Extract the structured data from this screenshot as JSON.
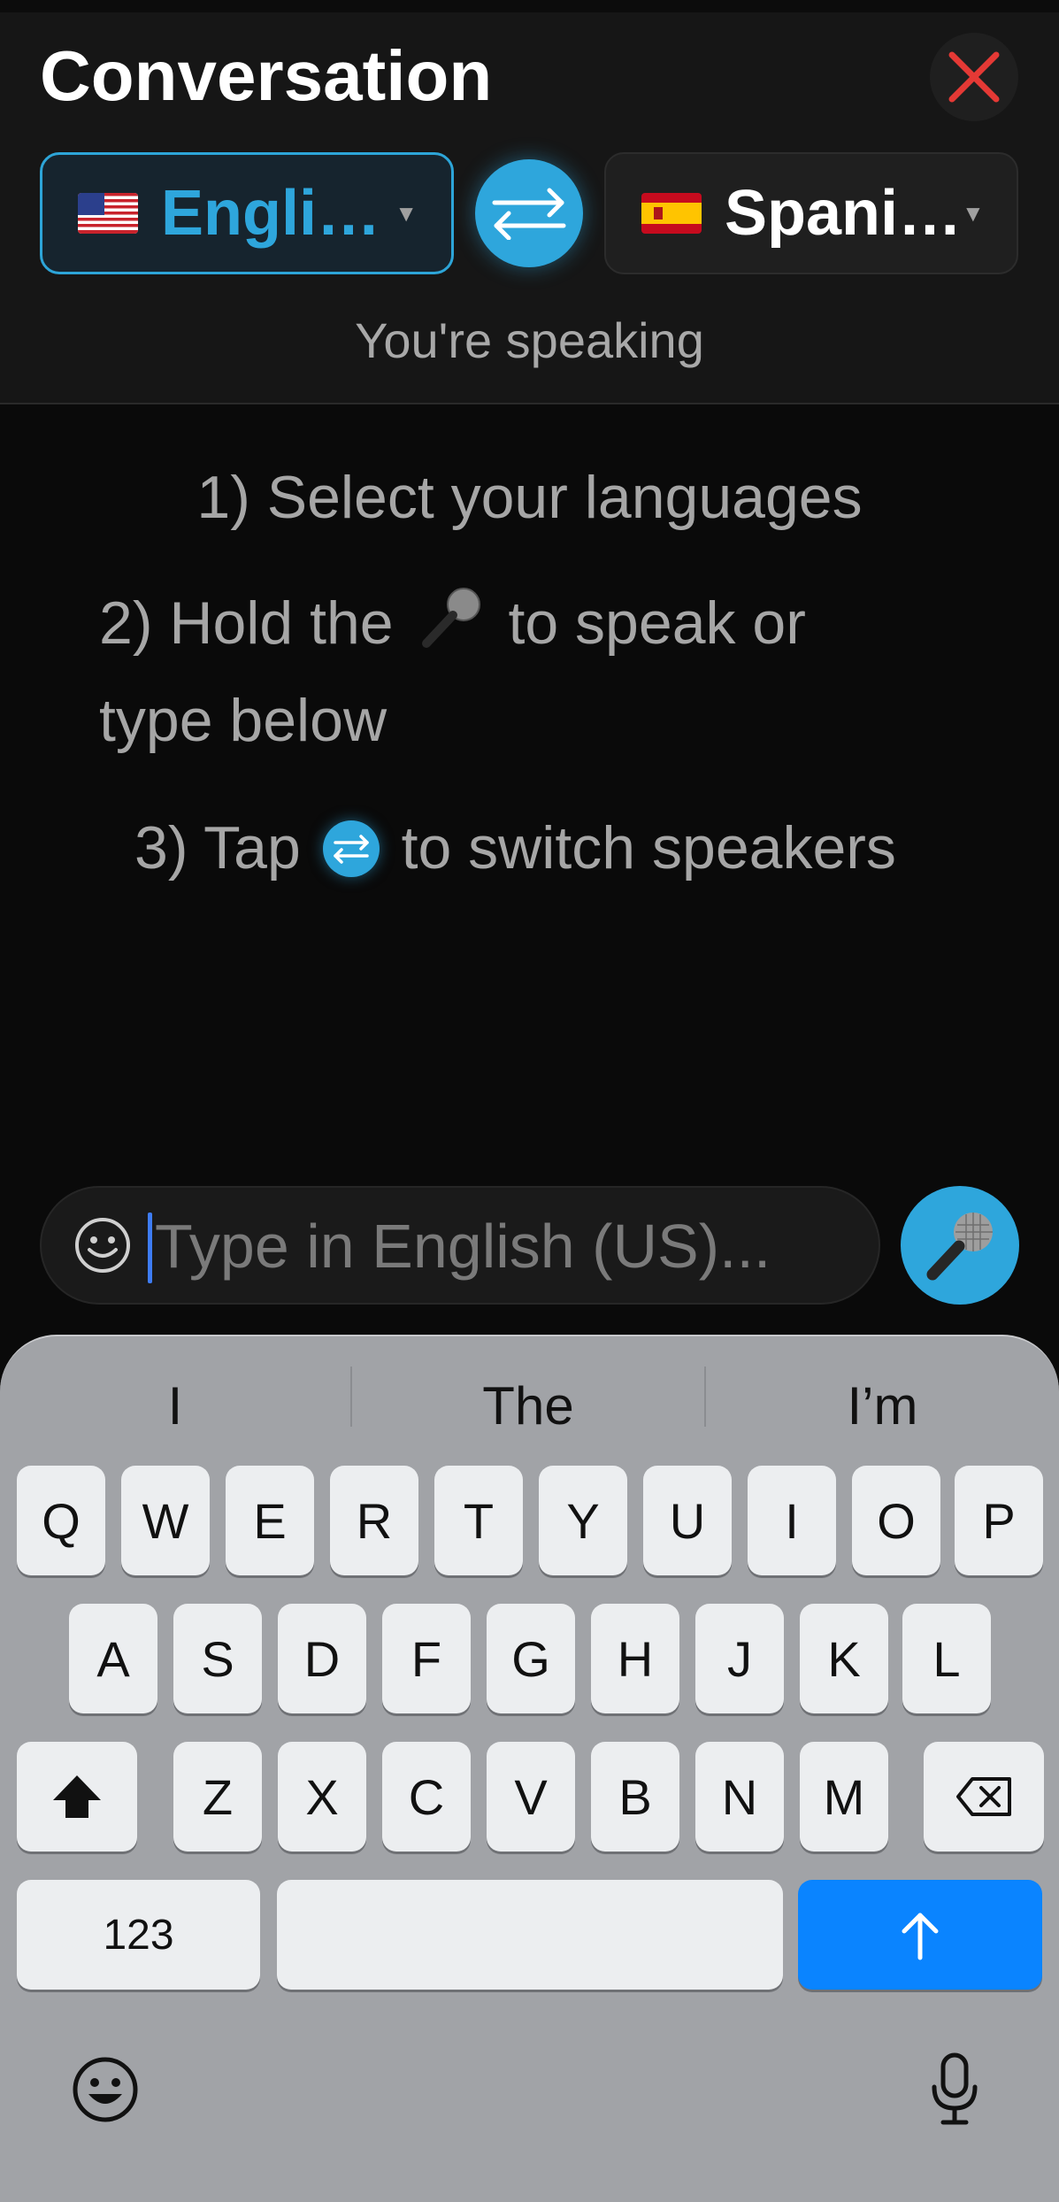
{
  "header": {
    "title": "Conversation",
    "source_language": "Engli…",
    "target_language": "Spani…",
    "speaking_status": "You're speaking"
  },
  "instructions": {
    "step1": "1) Select your languages",
    "step2_pre": "2) Hold the",
    "step2_post": "to speak or",
    "step2_line2": "type below",
    "step3_pre": "3) Tap",
    "step3_post": "to switch speakers"
  },
  "input": {
    "placeholder": "Type in English (US)...",
    "value": ""
  },
  "keyboard": {
    "suggestions": [
      "I",
      "The",
      "I’m"
    ],
    "row1": [
      "Q",
      "W",
      "E",
      "R",
      "T",
      "Y",
      "U",
      "I",
      "O",
      "P"
    ],
    "row2": [
      "A",
      "S",
      "D",
      "F",
      "G",
      "H",
      "J",
      "K",
      "L"
    ],
    "row3": [
      "Z",
      "X",
      "C",
      "V",
      "B",
      "N",
      "M"
    ],
    "numbers_label": "123"
  },
  "colors": {
    "accent": "#2ea6dc",
    "close": "#e53935",
    "return_key": "#0a84ff"
  },
  "icons": {
    "close": "close-icon",
    "swap": "swap-arrows-icon",
    "mic": "microphone-icon",
    "emoji": "emoji-icon",
    "shift": "shift-icon",
    "delete": "delete-icon",
    "return": "arrow-up-icon",
    "dictation": "dictation-icon"
  }
}
